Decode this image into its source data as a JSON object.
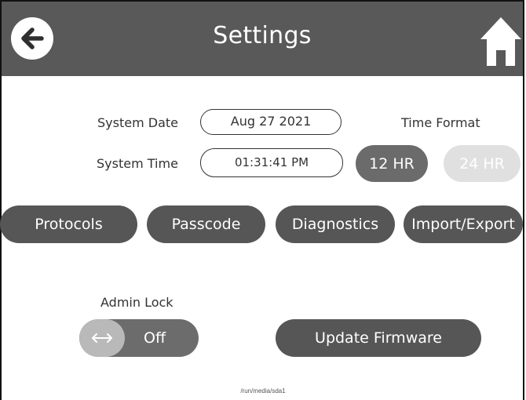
{
  "header": {
    "title": "Settings",
    "back_icon": "back-arrow-icon",
    "home_icon": "home-icon"
  },
  "date_time": {
    "system_date_label": "System Date",
    "system_date_value": "Aug 27 2021",
    "system_time_label": "System Time",
    "system_time_value": "01:31:41 PM",
    "time_format_label": "Time Format",
    "format_options": [
      "12 HR",
      "24 HR"
    ],
    "selected_format": "12 HR"
  },
  "menu_buttons": [
    "Protocols",
    "Passcode",
    "Diagnostics",
    "Import/Export"
  ],
  "admin_lock": {
    "label": "Admin Lock",
    "state": "Off",
    "icon": "double-arrow-icon"
  },
  "firmware": {
    "button_label": "Update Firmware",
    "path": "/run/media/sda1"
  },
  "colors": {
    "header_bg": "#595959",
    "button_dark": "#565656",
    "format_active": "#6b6b6b",
    "format_inactive": "#e0e0e0"
  }
}
